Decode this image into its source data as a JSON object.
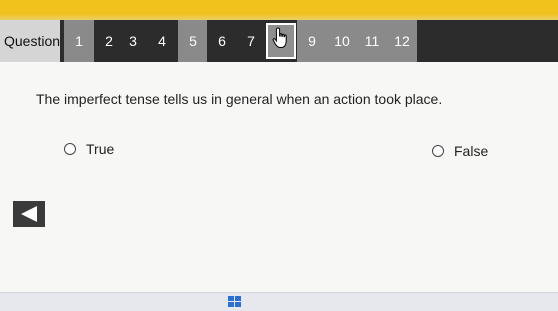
{
  "nav": {
    "question_label": "Question",
    "numbers": [
      "1",
      "2",
      "3",
      "4",
      "5",
      "6",
      "7",
      "8",
      "9",
      "10",
      "11",
      "12"
    ],
    "current": "8"
  },
  "question": {
    "text": "The imperfect tense tells us in general when an action took place."
  },
  "options": {
    "true_label": "True",
    "false_label": "False"
  },
  "colors": {
    "top_strip": "#f2c21a",
    "nav_dark": "#2c2c2c",
    "nav_light": "#8a8a8a",
    "nav_label_bg": "#d5d5d5"
  }
}
